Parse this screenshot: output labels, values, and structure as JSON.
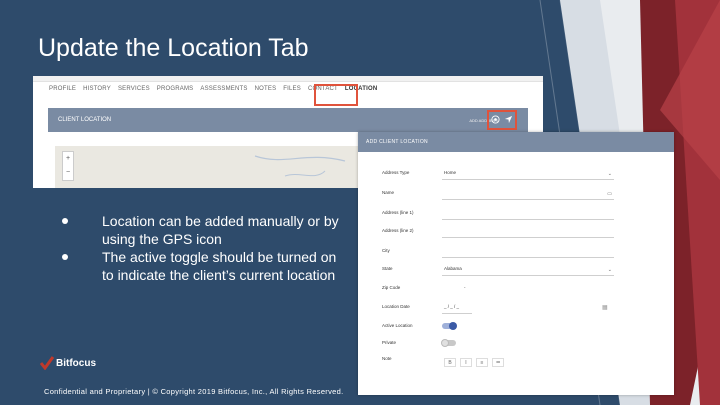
{
  "slide": {
    "title": "Update the Location Tab",
    "bullets": [
      "Location can be added manually or by using the GPS icon",
      "The active toggle should be turned on to indicate the client’s current location"
    ],
    "logo_text": "Bitfocus",
    "footer": "Confidential and Proprietary | © Copyright 2019 Bitfocus, Inc., All Rights Reserved."
  },
  "tabs_screen": {
    "tabs": [
      "PROFILE",
      "HISTORY",
      "SERVICES",
      "PROGRAMS",
      "ASSESSMENTS",
      "NOTES",
      "FILES",
      "CONTACT",
      "LOCATION"
    ],
    "panel_title": "CLIENT LOCATION",
    "add_address": "ADD ADDRESS",
    "map_zoom_in": "+",
    "map_zoom_out": "−"
  },
  "form": {
    "header": "ADD CLIENT LOCATION",
    "fields": {
      "address_type": {
        "label": "Address Type",
        "value": "Home"
      },
      "name": {
        "label": "Name",
        "value": ""
      },
      "address1": {
        "label": "Address (line 1)",
        "value": ""
      },
      "address2": {
        "label": "Address (line 2)",
        "value": ""
      },
      "city": {
        "label": "City",
        "value": ""
      },
      "state": {
        "label": "State",
        "value": "Alabama"
      },
      "zip": {
        "label": "Zip Code",
        "value": "-"
      },
      "location_date": {
        "label": "Location Date",
        "value": "_ / _ / _"
      },
      "active_location": {
        "label": "Active Location"
      },
      "private": {
        "label": "Private"
      },
      "note": {
        "label": "Note"
      }
    },
    "toolbar": [
      "B",
      "I",
      "≡",
      "≔"
    ]
  },
  "colors": {
    "background": "#2e4b6b",
    "accent_red": "#8e2b33",
    "highlight": "#e0533c",
    "panel": "#7a8ba3"
  }
}
